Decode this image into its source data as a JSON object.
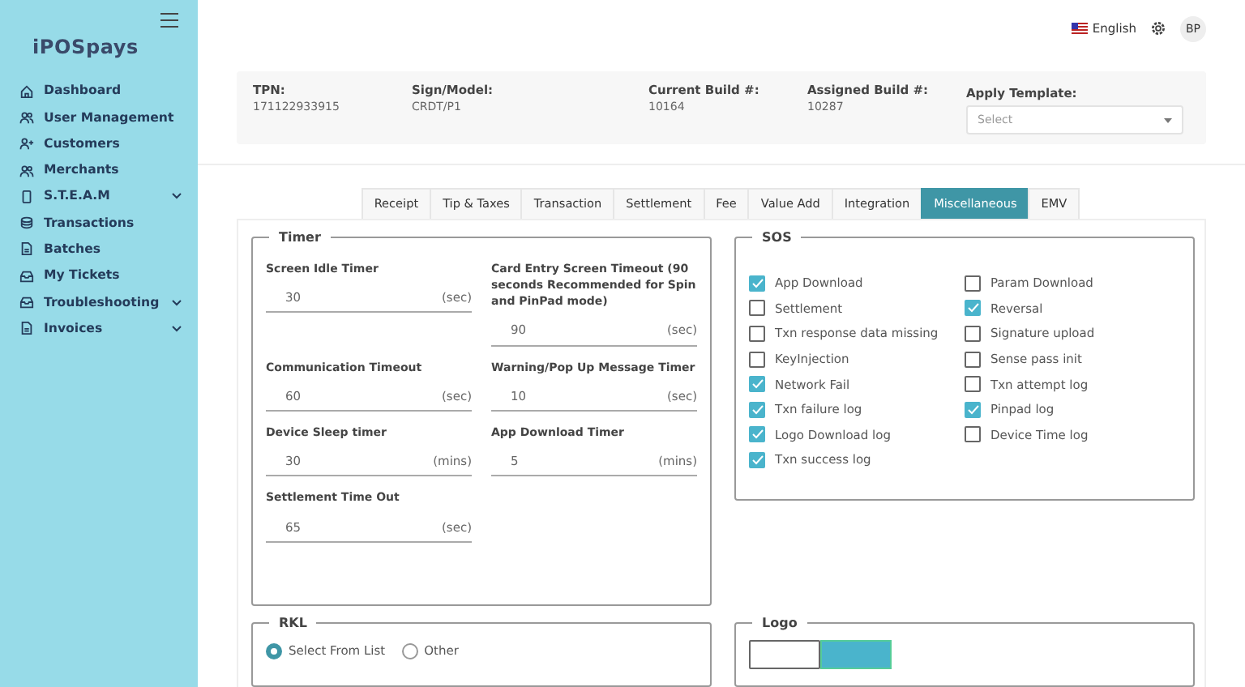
{
  "sidebar": {
    "items": [
      {
        "label": "Dashboard",
        "expandable": false
      },
      {
        "label": "User Management",
        "expandable": false
      },
      {
        "label": "Customers",
        "expandable": false
      },
      {
        "label": "Merchants",
        "expandable": false
      },
      {
        "label": "S.T.E.A.M",
        "expandable": true
      },
      {
        "label": "Transactions",
        "expandable": false
      },
      {
        "label": "Batches",
        "expandable": false
      },
      {
        "label": "My Tickets",
        "expandable": false
      },
      {
        "label": "Troubleshooting",
        "expandable": true
      },
      {
        "label": "Invoices",
        "expandable": true
      }
    ],
    "brand": "iPOSpays"
  },
  "header": {
    "language": "English",
    "avatar": "BP"
  },
  "info": {
    "fields": [
      {
        "label": "TPN:",
        "value": "171122933915"
      },
      {
        "label": "Sign/Model:",
        "value": "CRDT/P1"
      },
      {
        "label": "Current Build #:",
        "value": "10164"
      },
      {
        "label": "Assigned Build #:",
        "value": "10287"
      }
    ],
    "template": {
      "label": "Apply Template:",
      "placeholder": "Select"
    }
  },
  "tabs": [
    {
      "label": "Receipt",
      "selected": false
    },
    {
      "label": "Tip & Taxes",
      "selected": false
    },
    {
      "label": "Transaction",
      "selected": false
    },
    {
      "label": "Settlement",
      "selected": false
    },
    {
      "label": "Fee",
      "selected": false
    },
    {
      "label": "Value Add",
      "selected": false
    },
    {
      "label": "Integration",
      "selected": false
    },
    {
      "label": "Miscellaneous",
      "selected": true
    },
    {
      "label": "EMV",
      "selected": false
    }
  ],
  "timer": {
    "title": "Timer",
    "fields": [
      {
        "label": "Screen Idle Timer",
        "value": "30",
        "unit": "(sec)"
      },
      {
        "label": "Card Entry Screen Timeout (90 seconds Recommended for Spin and PinPad mode)",
        "value": "90",
        "unit": "(sec)"
      },
      {
        "label": "Communication Timeout",
        "value": "60",
        "unit": "(sec)"
      },
      {
        "label": "Warning/Pop Up Message Timer",
        "value": "10",
        "unit": "(sec)"
      },
      {
        "label": "Device Sleep timer",
        "value": "30",
        "unit": "(mins)"
      },
      {
        "label": "App Download Timer",
        "value": "5",
        "unit": "(mins)"
      },
      {
        "label": "Settlement Time Out",
        "value": "65",
        "unit": "(sec)"
      }
    ]
  },
  "sos": {
    "title": "SOS",
    "columns": [
      [
        {
          "label": "App Download",
          "checked": true
        },
        {
          "label": "Settlement",
          "checked": false
        },
        {
          "label": "Txn response data missing",
          "checked": false
        },
        {
          "label": "KeyInjection",
          "checked": false
        },
        {
          "label": "Network Fail",
          "checked": true
        },
        {
          "label": "Txn failure log",
          "checked": true
        },
        {
          "label": "Logo Download log",
          "checked": true
        },
        {
          "label": "Txn success log",
          "checked": true
        }
      ],
      [
        {
          "label": "Param Download",
          "checked": false
        },
        {
          "label": "Reversal",
          "checked": true
        },
        {
          "label": "Signature upload",
          "checked": false
        },
        {
          "label": "Sense pass init",
          "checked": false
        },
        {
          "label": "Txn attempt log",
          "checked": false
        },
        {
          "label": "Pinpad log",
          "checked": true
        },
        {
          "label": "Device Time log",
          "checked": false
        }
      ]
    ]
  },
  "rkl": {
    "title": "RKL",
    "options": [
      {
        "label": "Select From List",
        "selected": true
      },
      {
        "label": "Other",
        "selected": false
      }
    ]
  },
  "logo": {
    "title": "Logo"
  }
}
